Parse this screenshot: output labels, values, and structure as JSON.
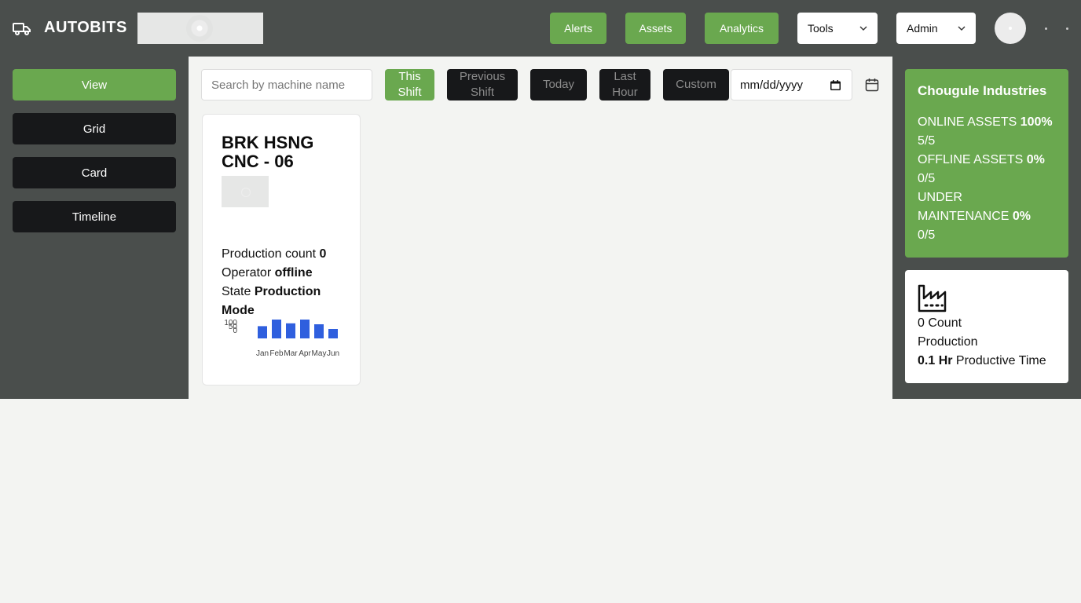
{
  "header": {
    "brand": "AUTOBITS",
    "nav": {
      "alerts": "Alerts",
      "assets": "Assets",
      "analytics": "Analytics"
    },
    "tools_label": "Tools",
    "user_label": "Admin"
  },
  "sidebar": {
    "items": [
      {
        "label": "View",
        "active": true
      },
      {
        "label": "Grid",
        "active": false
      },
      {
        "label": "Card",
        "active": false
      },
      {
        "label": "Timeline",
        "active": false
      }
    ]
  },
  "filters": {
    "search_placeholder": "Search by machine name",
    "this_shift": "This Shift",
    "previous_shift": "Previous Shift",
    "today": "Today",
    "last_hour": "Last Hour",
    "custom": "Custom",
    "date_value": "mm/dd/yyyy"
  },
  "machine": {
    "title": "BRK HSNG CNC - 06",
    "production_count_label": "Production count",
    "production_count_value": "0",
    "operator_label": "Operator",
    "operator_value": "offline",
    "state_label": "State",
    "state_value": "Production Mode"
  },
  "chart_data": {
    "type": "bar",
    "categories": [
      "Jan",
      "Feb",
      "Mar",
      "Apr",
      "May",
      "Jun"
    ],
    "values": [
      65,
      100,
      80,
      100,
      75,
      50
    ],
    "y_ticks": [
      "100",
      "50",
      "0"
    ],
    "bar_color": "#2f5fde"
  },
  "summary": {
    "company": "Chougule Industries",
    "online_label": "ONLINE ASSETS",
    "online_pct": "100%",
    "online_ratio": "5/5",
    "offline_label": "OFFLINE ASSETS",
    "offline_pct": "0%",
    "offline_ratio": "0/5",
    "maint_label_1": "UNDER",
    "maint_label_2": "MAINTENANCE",
    "maint_pct": "0%",
    "maint_ratio": "0/5"
  },
  "production": {
    "count": "0 Count",
    "label": "Production",
    "productive_value": "0.1 Hr",
    "productive_label": "Productive Time"
  },
  "colors": {
    "header_bg": "#4a4e4c",
    "accent_green": "#6aa84f",
    "dark_button": "#17181a",
    "chart_blue": "#2f5fde"
  }
}
